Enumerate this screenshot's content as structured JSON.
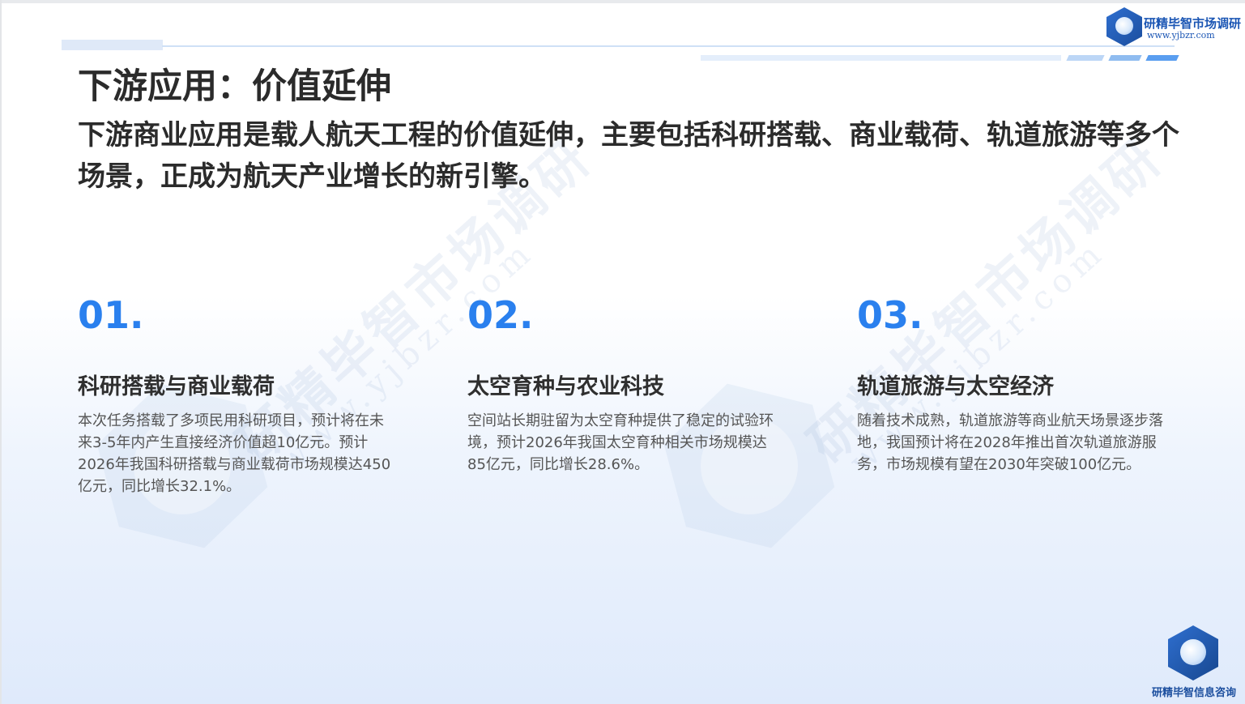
{
  "header": {
    "title": "下游应用：价值延伸",
    "subtitle": "下游商业应用是载人航天工程的价值延伸，主要包括科研搭载、商业载荷、轨道旅游等多个场景，正成为航天产业增长的新引擎。"
  },
  "logo": {
    "name": "研精毕智市场调研",
    "url": "www.yjbzr.com",
    "icon": "globe-hexagon-icon"
  },
  "watermark": {
    "text": "研精毕智市场调研",
    "url": "www.yjbzr.com"
  },
  "cards": [
    {
      "number": "01.",
      "title": "科研搭载与商业载荷",
      "body": "本次任务搭载了多项民用科研项目，预计将在未来3-5年内产生直接经济价值超10亿元。预计2026年我国科研搭载与商业载荷市场规模达450亿元，同比增长32.1%。"
    },
    {
      "number": "02.",
      "title": "太空育种与农业科技",
      "body": "空间站长期驻留为太空育种提供了稳定的试验环境，预计2026年我国太空育种相关市场规模达85亿元，同比增长28.6%。"
    },
    {
      "number": "03.",
      "title": "轨道旅游与太空经济",
      "body": "随着技术成熟，轨道旅游等商业航天场景逐步落地，我国预计将在2028年推出首次轨道旅游服务，市场规模有望在2030年突破100亿元。"
    }
  ],
  "footer_logo": {
    "name": "研精毕智信息咨询",
    "icon": "globe-hexagon-icon"
  },
  "colors": {
    "accent": "#2a80ee",
    "brand": "#1b56b4",
    "text": "#2b2b2b"
  }
}
